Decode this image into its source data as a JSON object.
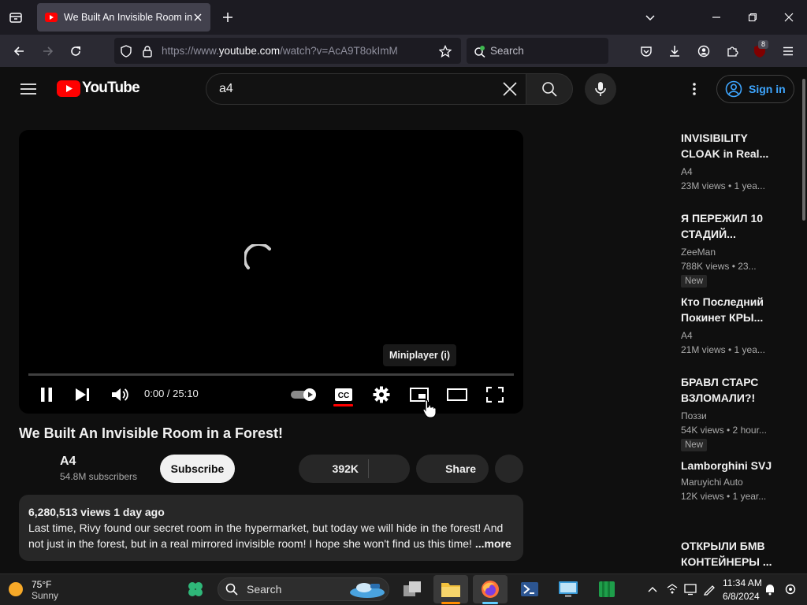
{
  "browser": {
    "tab_title": "We Built An Invisible Room in a Forest! - YouTube",
    "url_prefix": "https://www.",
    "url_domain": "youtube.com",
    "url_path": "/watch?v=AcA9T8okImM",
    "search_placeholder": "Search",
    "extension_badge": "8"
  },
  "youtube": {
    "logo_text": "YouTube",
    "search_query": "a4",
    "sign_in_label": "Sign in"
  },
  "player": {
    "time": "0:00 / 25:10",
    "tooltip": "Miniplayer (i)",
    "progress": 0.0
  },
  "video": {
    "title": "We Built An Invisible Room in a Forest!",
    "channel": "A4",
    "subscribers": "54.8M subscribers",
    "subscribe_label": "Subscribe",
    "likes": "392K",
    "share_label": "Share",
    "views_date": "6,280,513 views  1 day ago",
    "description": "Last time, Rivy found our secret room in the hypermarket, but today we will hide in the forest! And not just in the forest, but in a real mirrored invisible room! I hope she won't find us this time! ",
    "more_label": "...more"
  },
  "recommendations": [
    {
      "title": "INVISIBILITY CLOAK in Real...",
      "channel": "A4",
      "meta": "23M views • 1 yea...",
      "badge": ""
    },
    {
      "title": "Я ПЕРЕЖИЛ 10 СТАДИЙ...",
      "channel": "ZeeMan",
      "meta": "788K views • 23...",
      "badge": "New"
    },
    {
      "title": "Кто Последний Покинет КРЫ...",
      "channel": "A4",
      "meta": "21M views • 1 yea...",
      "badge": ""
    },
    {
      "title": "БРАВЛ СТАРС ВЗЛОМАЛИ?!",
      "channel": "Поззи",
      "meta": "54K views • 2 hour...",
      "badge": "New"
    },
    {
      "title": "Lamborghini SVJ",
      "channel": "Maruyichi Auto",
      "meta": "12K views • 1 year...",
      "badge": ""
    },
    {
      "title": "ОТКРЫЛИ БМВ КОНТЕЙНЕРЫ ...",
      "channel": "",
      "meta": "",
      "badge": ""
    }
  ],
  "taskbar": {
    "temp": "75°F",
    "weather": "Sunny",
    "search_label": "Search",
    "time": "11:34 AM",
    "date": "6/8/2024"
  },
  "colors": {
    "youtube_red": "#ff0000",
    "link_blue": "#3ea6ff",
    "cc_underline": "#ff0000"
  }
}
